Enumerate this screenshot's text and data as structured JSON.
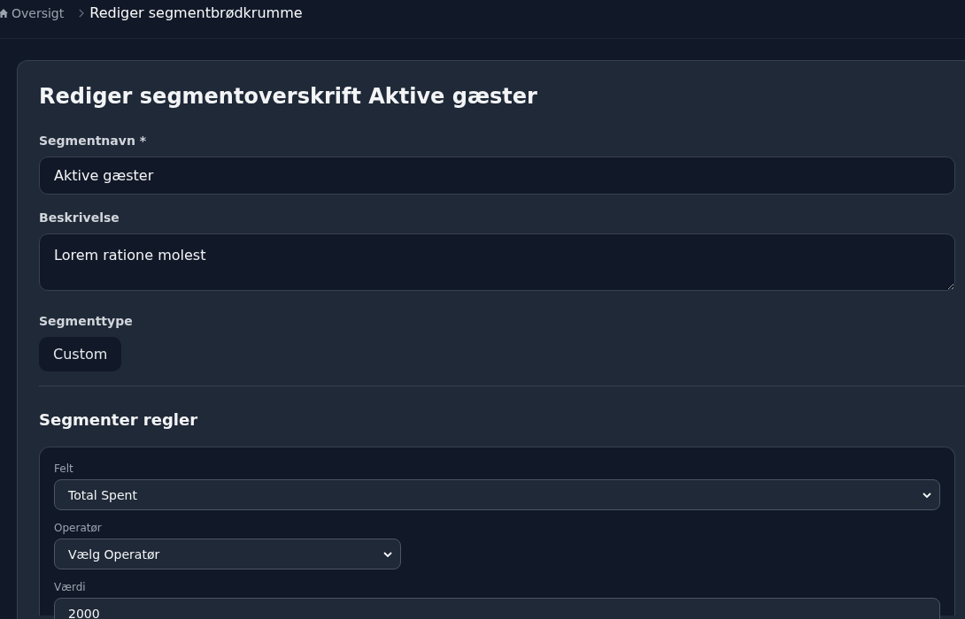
{
  "breadcrumb": [
    {
      "label": "Oversigt",
      "current": false
    },
    {
      "label": "Rediger segmentbrødkrumme",
      "current": true
    }
  ],
  "card": {
    "title": "Rediger segmentoverskrift Aktive gæster",
    "fields": [
      {
        "kind": "input",
        "label": "Segmentnavn *",
        "value": "Aktive gæster"
      },
      {
        "kind": "textarea",
        "label": "Beskrivelse",
        "value": "Lorem ratione molest"
      },
      {
        "kind": "chip",
        "label": "Segmenttype",
        "value": "Custom"
      }
    ]
  },
  "rules": {
    "title": "Segmenter regler",
    "field": {
      "label": "Felt",
      "value": "Total Spent"
    },
    "operator": {
      "label": "Operatør",
      "value": "Vælg Operatør"
    },
    "value": {
      "label": "Værdi",
      "value": "2000"
    }
  }
}
